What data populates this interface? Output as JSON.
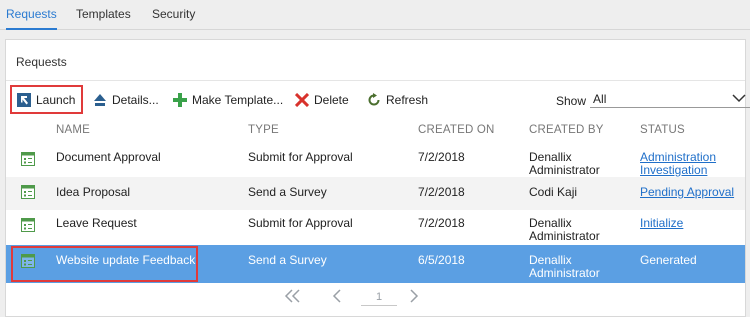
{
  "tabs": [
    {
      "label": "Requests",
      "active": true
    },
    {
      "label": "Templates",
      "active": false
    },
    {
      "label": "Security",
      "active": false
    }
  ],
  "panel": {
    "title": "Requests"
  },
  "toolbar": {
    "launch": "Launch",
    "details": "Details...",
    "make_template": "Make Template...",
    "delete": "Delete",
    "refresh": "Refresh",
    "show_label": "Show",
    "show_value": "All"
  },
  "table": {
    "headers": [
      "NAME",
      "TYPE",
      "CREATED ON",
      "CREATED BY",
      "STATUS"
    ],
    "rows": [
      {
        "name": "Document Approval",
        "type": "Submit for Approval",
        "created_on": "7/2/2018",
        "created_by": "Denallix Administrator",
        "status": "Administration Investigation"
      },
      {
        "name": "Idea Proposal",
        "type": "Send a Survey",
        "created_on": "7/2/2018",
        "created_by": "Codi Kaji",
        "status": "Pending Approval"
      },
      {
        "name": "Leave Request",
        "type": "Submit for Approval",
        "created_on": "7/2/2018",
        "created_by": "Denallix Administrator",
        "status": "Initialize"
      },
      {
        "name": "Website update Feedback",
        "type": "Send a Survey",
        "created_on": "6/5/2018",
        "created_by": "Denallix Administrator",
        "status": "Generated"
      }
    ]
  },
  "pager": {
    "page": "1"
  },
  "colors": {
    "accent": "#2b7bd1",
    "selected_row": "#5b9fe3",
    "highlight": "#e03a3a",
    "link": "#1f6fc9"
  }
}
